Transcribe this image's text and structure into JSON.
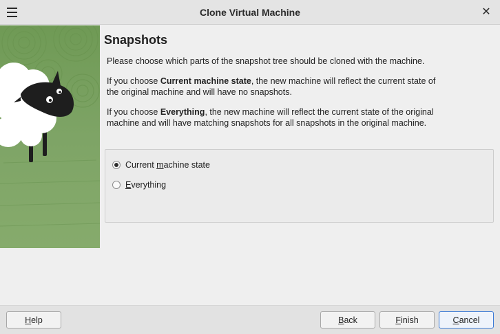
{
  "window": {
    "title": "Clone Virtual Machine",
    "close_glyph": "✕"
  },
  "page": {
    "heading": "Snapshots",
    "intro": "Please choose which parts of the snapshot tree should be cloned with the machine.",
    "current_pre": "If you choose ",
    "current_bold": "Current machine state",
    "current_post": ", the new machine will reflect the current state of the original machine and will have no snapshots.",
    "everything_pre": "If you choose ",
    "everything_bold": "Everything",
    "everything_post": ", the new machine will reflect the current state of the original machine and will have matching snapshots for all snapshots in the original machine."
  },
  "options": {
    "selected": "current",
    "items": [
      {
        "id": "current",
        "label_pre": "Current ",
        "label_accel": "m",
        "label_post": "achine state",
        "checked": true
      },
      {
        "id": "everything",
        "label_pre": "",
        "label_accel": "E",
        "label_post": "verything",
        "checked": false
      }
    ]
  },
  "buttons": {
    "help": {
      "accel": "H",
      "rest": "elp"
    },
    "back": {
      "accel": "B",
      "rest": "ack"
    },
    "finish": {
      "accel": "F",
      "rest": "inish"
    },
    "cancel": {
      "accel": "C",
      "rest": "ancel"
    }
  },
  "colors": {
    "watermark_bg": "#7ea466",
    "default_button_border": "#3b7bd6"
  },
  "icons": {
    "menu": "hamburger-icon",
    "close": "close-icon",
    "watermark": "sheep-illustration"
  }
}
